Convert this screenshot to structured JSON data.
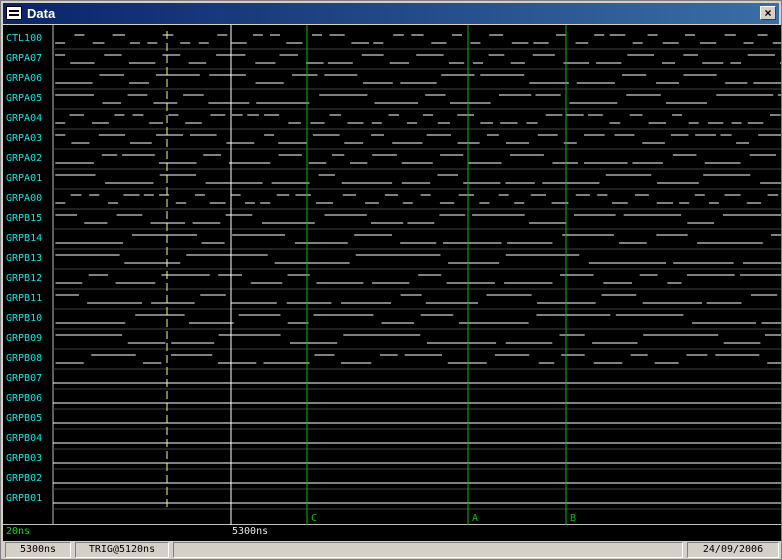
{
  "window": {
    "title": "Data",
    "close_label": "×"
  },
  "channels": [
    "CTL100",
    "GRPA07",
    "GRPA06",
    "GRPA05",
    "GRPA04",
    "GRPA03",
    "GRPA02",
    "GRPA01",
    "GRPA00",
    "GRPB15",
    "GRPB14",
    "GRPB13",
    "GRPB12",
    "GRPB11",
    "GRPB10",
    "GRPB09",
    "GRPB08",
    "GRPB07",
    "GRPB06",
    "GRPB05",
    "GRPB04",
    "GRPB03",
    "GRPB02",
    "GRPB01"
  ],
  "timebase": {
    "start_label": "20ns",
    "cursor_label": "5300ns"
  },
  "markers": [
    {
      "label": "C",
      "color": "#00c000"
    },
    {
      "label": "A",
      "color": "#00c000"
    },
    {
      "label": "B",
      "color": "#00c000"
    }
  ],
  "colors": {
    "channel_name": "#00e8e8",
    "trace": "#ffffff",
    "grid": "#404040",
    "marker": "#00c000",
    "trigger": "#ffff66",
    "cursor": "#ffffff"
  },
  "status": {
    "time": "5300ns",
    "trigger": "TRIG@5120ns",
    "date": "24/09/2006"
  }
}
